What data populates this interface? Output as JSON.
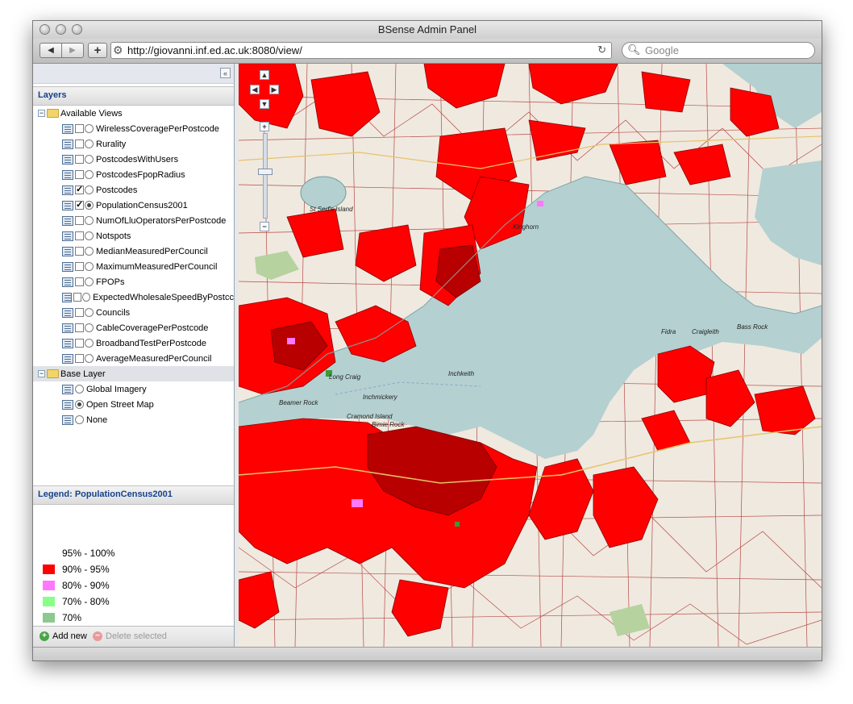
{
  "window": {
    "title": "BSense Admin Panel"
  },
  "browser": {
    "url": "http://giovanni.inf.ed.ac.uk:8080/view/",
    "search_placeholder": "Google"
  },
  "layers_panel": {
    "title": "Layers",
    "available_views_label": "Available Views",
    "views": [
      {
        "label": "WirelessCoveragePerPostcode",
        "checked": false,
        "selected": false
      },
      {
        "label": "Rurality",
        "checked": false,
        "selected": false
      },
      {
        "label": "PostcodesWithUsers",
        "checked": false,
        "selected": false
      },
      {
        "label": "PostcodesFpopRadius",
        "checked": false,
        "selected": false
      },
      {
        "label": "Postcodes",
        "checked": true,
        "selected": false
      },
      {
        "label": "PopulationCensus2001",
        "checked": true,
        "selected": true
      },
      {
        "label": "NumOfLluOperatorsPerPostcode",
        "checked": false,
        "selected": false
      },
      {
        "label": "Notspots",
        "checked": false,
        "selected": false
      },
      {
        "label": "MedianMeasuredPerCouncil",
        "checked": false,
        "selected": false
      },
      {
        "label": "MaximumMeasuredPerCouncil",
        "checked": false,
        "selected": false
      },
      {
        "label": "FPOPs",
        "checked": false,
        "selected": false
      },
      {
        "label": "ExpectedWholesaleSpeedByPostcc",
        "checked": false,
        "selected": false
      },
      {
        "label": "Councils",
        "checked": false,
        "selected": false
      },
      {
        "label": "CableCoveragePerPostcode",
        "checked": false,
        "selected": false
      },
      {
        "label": "BroadbandTestPerPostcode",
        "checked": false,
        "selected": false
      },
      {
        "label": "AverageMeasuredPerCouncil",
        "checked": false,
        "selected": false
      }
    ],
    "base_layer_label": "Base Layer",
    "base_layers": [
      {
        "label": "Global Imagery",
        "selected": false
      },
      {
        "label": "Open Street Map",
        "selected": true
      },
      {
        "label": "None",
        "selected": false
      }
    ]
  },
  "legend": {
    "title": "Legend: PopulationCensus2001",
    "items": [
      {
        "label": "95% - 100%",
        "color": "#ffffff"
      },
      {
        "label": "90% - 95%",
        "color": "#ff0000"
      },
      {
        "label": "80% - 90%",
        "color": "#ff77ff"
      },
      {
        "label": "70% - 80%",
        "color": "#88ff88"
      },
      {
        "label": "70%",
        "color": "#8cc98c"
      }
    ]
  },
  "actions": {
    "add_label": "Add new",
    "delete_label": "Delete selected"
  },
  "map": {
    "labels": [
      "St Serf's Island",
      "Fidra",
      "Craigleith",
      "Bass Rock",
      "Inchkeith",
      "Inchmickery",
      "Beamer Rock",
      "Cramond Island",
      "Bimie Rock",
      "Long Craig",
      "Kinghorn"
    ],
    "colors": {
      "land": "#f0e9df",
      "water": "#b4d0d1",
      "region_fill": "#ff0000",
      "region_border": "#8b0000",
      "park": "#b5d29f"
    }
  }
}
